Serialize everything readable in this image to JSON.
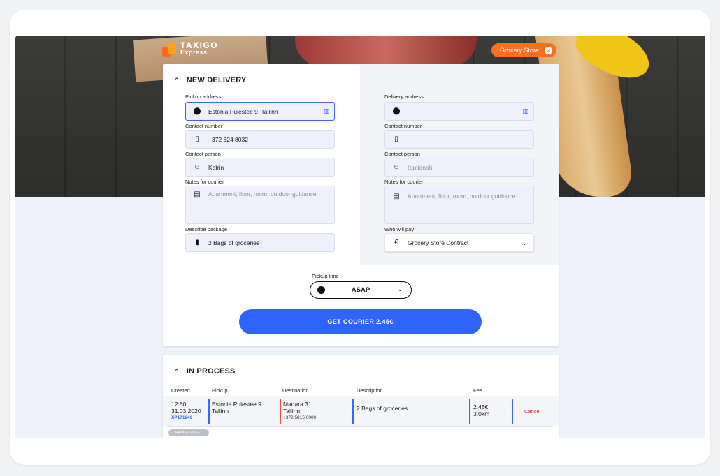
{
  "brand": {
    "name_line1": "TAXIGO",
    "name_line2": "Express",
    "accent": "#ff6e1f",
    "primary": "#2e63ff"
  },
  "store_badge": {
    "label": "Grocery Store",
    "close_icon": "close-icon"
  },
  "new_delivery": {
    "title": "NEW DELIVERY",
    "pickup": {
      "address_label": "Pickup address",
      "address_value": "Estonia Puiestee 9, Tallinn",
      "contact_label": "Contact number",
      "contact_value": "+372 624 8032",
      "person_label": "Contact person",
      "person_value": "Katrin",
      "notes_label": "Notes for courier",
      "notes_placeholder": "Apartment, floor, room, outdoor guidance.",
      "package_label": "Describe package",
      "package_value": "2 Bags of groceries"
    },
    "delivery": {
      "address_label": "Delivery address",
      "address_value": "",
      "contact_label": "Contact number",
      "contact_value": "",
      "person_label": "Contact person",
      "person_placeholder": "(optional)",
      "notes_label": "Notes for courier",
      "notes_placeholder": "Apartment, floor, room, outdoor guidance.",
      "payer_label": "Who will pay",
      "payer_value": "Grocery Store Contract"
    },
    "pickup_time": {
      "label": "Pickup time",
      "value": "ASAP"
    },
    "cta_label": "GET COURIER  2.45€"
  },
  "in_process": {
    "title": "IN PROCESS",
    "columns": [
      "Created",
      "Pickup",
      "Destination",
      "Description",
      "Fee"
    ],
    "rows": [
      {
        "created_time": "12:50",
        "created_date": "31.03.2020",
        "order_id": "XP171249",
        "pickup_line1": "Estonia Puiestee 9",
        "pickup_line2": "Tallinn",
        "dest_line1": "Madara 31",
        "dest_line2": "Tallinn",
        "dest_phone": "+372 5815 0000",
        "description": "2 Bags of groceries",
        "fee": "2.45€",
        "distance": "3.0km",
        "action": "Cancel",
        "status": "REQUESTING..."
      }
    ]
  }
}
